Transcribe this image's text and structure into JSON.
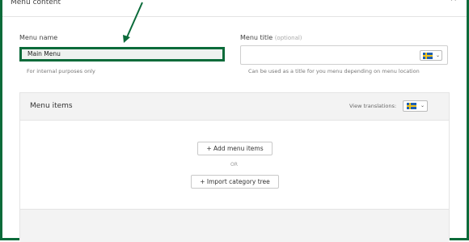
{
  "section": {
    "title": "Menu content",
    "collapse_glyph": "^"
  },
  "menu_name": {
    "label": "Menu name",
    "value": "Main Menu",
    "helper": "For internal purposes only"
  },
  "menu_title": {
    "label": "Menu title",
    "optional": "(optional)",
    "value": "",
    "helper": "Can be used as a title for you menu depending on menu location",
    "language_flag": "sweden-flag-icon"
  },
  "menu_items": {
    "title": "Menu items",
    "view_translations_label": "View translations:",
    "translation_flag": "sweden-flag-icon",
    "add_button": "+ Add menu items",
    "or_text": "OR",
    "import_button": "+ Import category tree"
  },
  "colors": {
    "highlight": "#0b6b3a",
    "panel_bg": "#f3f3f3"
  }
}
